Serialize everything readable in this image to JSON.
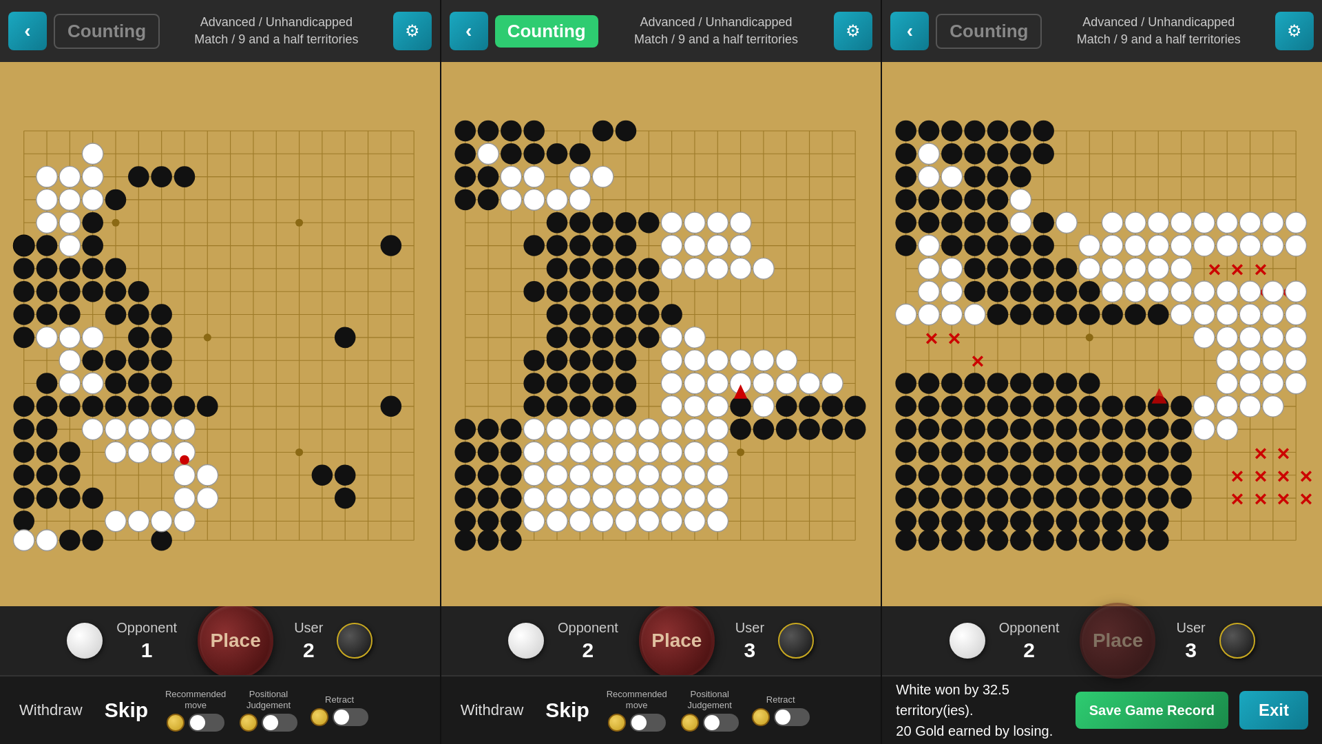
{
  "panels": [
    {
      "id": "panel1",
      "header": {
        "back_label": "‹",
        "counting_label": "Counting",
        "counting_active": false,
        "match_info": "Advanced / Unhandicapped\nMatch / 9 and a half territories",
        "gear_label": "⚙"
      },
      "score": {
        "opponent_label": "Opponent",
        "opponent_score": "1",
        "place_label": "Place",
        "user_label": "User",
        "user_score": "2"
      },
      "bottom": {
        "withdraw_label": "Withdraw",
        "skip_label": "Skip",
        "recommended_label": "Recommended move",
        "positional_label": "Positional Judgement",
        "retract_label": "Retract",
        "show_result": false
      }
    },
    {
      "id": "panel2",
      "header": {
        "back_label": "‹",
        "counting_label": "Counting",
        "counting_active": true,
        "match_info": "Advanced / Unhandicapped\nMatch / 9 and a half territories",
        "gear_label": "⚙"
      },
      "score": {
        "opponent_label": "Opponent",
        "opponent_score": "2",
        "place_label": "Place",
        "user_label": "User",
        "user_score": "3"
      },
      "bottom": {
        "withdraw_label": "Withdraw",
        "skip_label": "Skip",
        "recommended_label": "Recommended move",
        "positional_label": "Positional Judgement",
        "retract_label": "Retract",
        "show_result": false
      }
    },
    {
      "id": "panel3",
      "header": {
        "back_label": "‹",
        "counting_label": "Counting",
        "counting_active": false,
        "match_info": "Advanced / Unhandicapped\nMatch / 9 and a half territories",
        "gear_label": "⚙"
      },
      "score": {
        "opponent_label": "Opponent",
        "opponent_score": "2",
        "place_label": "Place",
        "user_label": "User",
        "user_score": "3"
      },
      "bottom": {
        "show_result": true,
        "result_line1": "White won by 32.5 territory(ies).",
        "result_line2": "20 Gold earned by losing.",
        "save_label": "Save Game\nRecord",
        "exit_label": "Exit"
      }
    }
  ],
  "colors": {
    "board": "#c8a456",
    "header_bg": "#2a2a2a",
    "active_counting": "#2ecc71",
    "back_btn": "#1aa8c0",
    "place_btn_bg": "#3d0a0a"
  }
}
